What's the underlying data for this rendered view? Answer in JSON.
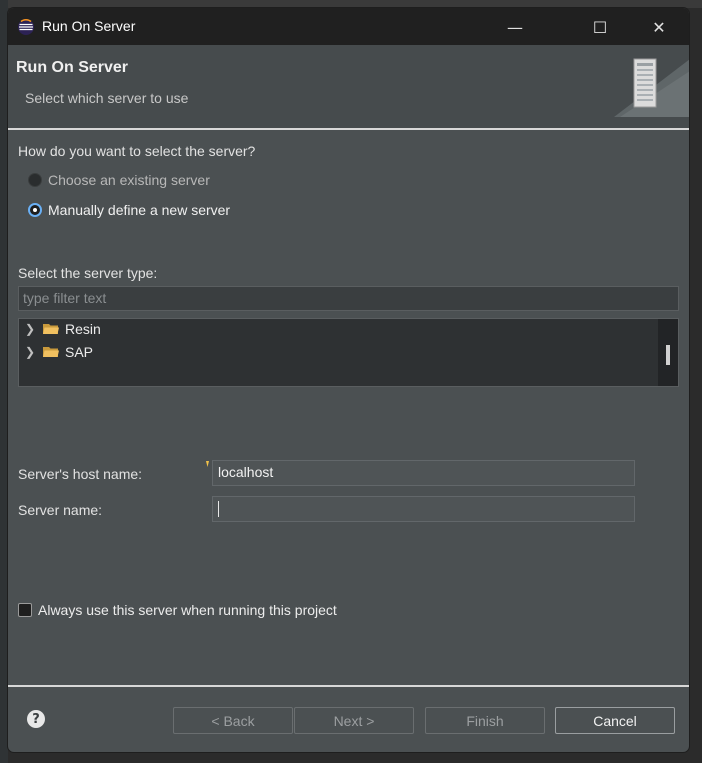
{
  "window": {
    "title": "Run On Server",
    "minimize_glyph": "—",
    "maximize_glyph": "☐",
    "close_glyph": "✕"
  },
  "header": {
    "title": "Run On Server",
    "subtitle": "Select which server to use",
    "icon": "server-icon"
  },
  "selection": {
    "question": "How do you want to select the server?",
    "options": [
      {
        "label": "Choose an existing server",
        "selected": false,
        "enabled": false
      },
      {
        "label": "Manually define a new server",
        "selected": true,
        "enabled": true
      }
    ]
  },
  "server_type": {
    "label": "Select the server type:",
    "filter_placeholder": "type filter text",
    "items": [
      {
        "label": "Resin",
        "icon": "folder-icon"
      },
      {
        "label": "SAP",
        "icon": "folder-icon"
      }
    ]
  },
  "fields": {
    "host_label": "Server's host name:",
    "host_value": "localhost",
    "name_label": "Server name:",
    "name_value": ""
  },
  "always_use": {
    "label": "Always use this server when running this project",
    "checked": false
  },
  "buttons": {
    "help": "?",
    "back": "< Back",
    "next": "Next >",
    "finish": "Finish",
    "cancel": "Cancel"
  },
  "colors": {
    "dialog_bg": "#4b5052",
    "titlebar_bg": "#202020",
    "radio_accent": "#6ab0f5",
    "folder": "#e2b24a"
  }
}
